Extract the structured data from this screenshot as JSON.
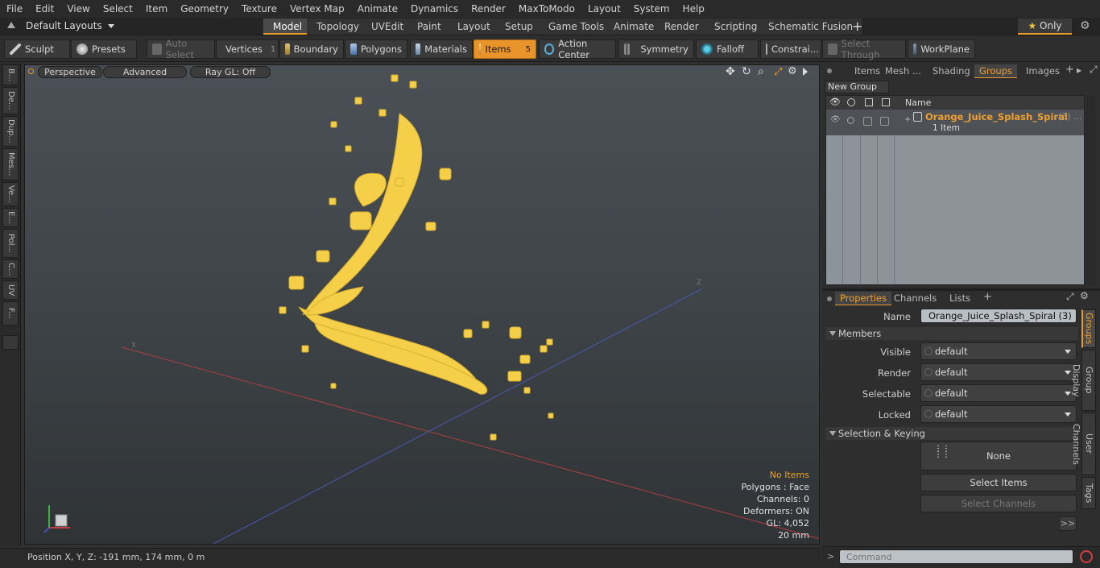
{
  "menu": [
    "File",
    "Edit",
    "View",
    "Select",
    "Item",
    "Geometry",
    "Texture",
    "Vertex Map",
    "Animate",
    "Dynamics",
    "Render",
    "MaxToModo",
    "Layout",
    "System",
    "Help"
  ],
  "layout_selector": "Default Layouts",
  "layout_tabs": [
    "Model",
    "Topology",
    "UVEdit",
    "Paint",
    "Layout",
    "Setup",
    "Game Tools",
    "Animate",
    "Render",
    "Scripting",
    "Schematic Fusion"
  ],
  "only_label": "Only",
  "toolbar": {
    "sculpt": "Sculpt",
    "presets": "Presets",
    "auto_select": "Auto Select",
    "vertices": "Vertices",
    "vertices_count": "1",
    "boundary": "Boundary",
    "polygons": "Polygons",
    "materials": "Materials",
    "items": "Items",
    "items_count": "5",
    "action_center": "Action Center",
    "symmetry": "Symmetry",
    "falloff": "Falloff",
    "constraints": "Constrai...",
    "select_through": "Select Through",
    "workplane": "WorkPlane"
  },
  "left_tabs": [
    "B...",
    "De...",
    "Dup...",
    "Mes...",
    "Ve...",
    "E...",
    "Pol...",
    "C...",
    "UV",
    "F..."
  ],
  "viewport": {
    "perspective": "Perspective",
    "advanced": "Advanced",
    "raygl": "Ray GL: Off",
    "stats": {
      "no_items": "No Items",
      "polygons": "Polygons : Face",
      "channels": "Channels: 0",
      "deformers": "Deformers: ON",
      "gl": "GL: 4,052",
      "scale": "20 mm"
    }
  },
  "status": {
    "position": "Position X, Y, Z:  -191 mm, 174 mm, 0 m"
  },
  "top_panel": {
    "tabs": [
      "Items",
      "Mesh ...",
      "Shading",
      "Groups",
      "Images"
    ],
    "new_group": "New Group",
    "col_name": "Name",
    "group_name": "Orange_Juice_Splash_Spiral",
    "group_count": "(3) ...",
    "group_sub": "1 Item"
  },
  "props_panel": {
    "tabs": [
      "Properties",
      "Channels",
      "Lists"
    ],
    "name_label": "Name",
    "name_value": "Orange_Juice_Splash_Spiral (3)",
    "members": "Members",
    "visible_label": "Visible",
    "visible_value": "default",
    "render_label": "Render",
    "render_value": "default",
    "selectable_label": "Selectable",
    "selectable_value": "default",
    "locked_label": "Locked",
    "locked_value": "default",
    "sel_keying": "Selection & Keying",
    "none_label": "None",
    "select_items": "Select Items",
    "select_channels": "Select Channels",
    "more": ">>",
    "side_tabs": [
      "Groups",
      "Group Display",
      "User Channels",
      "Tags"
    ]
  },
  "command_placeholder": "Command",
  "colors": {
    "accent": "#e89a2c",
    "splash": "#f4cf47",
    "group_name": "#f0a030"
  }
}
